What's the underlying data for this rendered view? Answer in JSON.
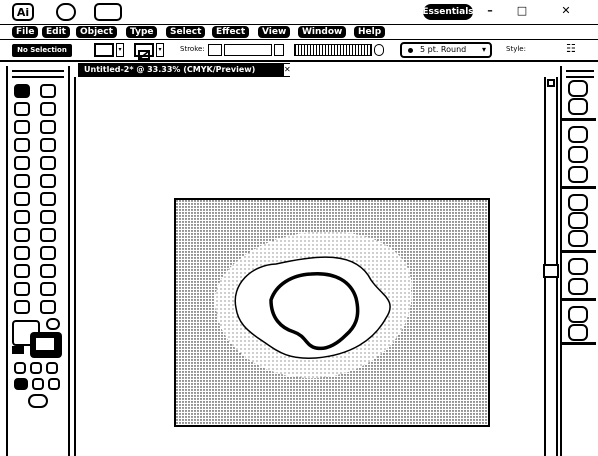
{
  "titlebar": {
    "app_logo": "Ai",
    "workspace_label": "Essentials",
    "minimize_glyph": "–",
    "maximize_glyph": "□",
    "close_glyph": "✕"
  },
  "menu": {
    "items": [
      "File",
      "Edit",
      "Object",
      "Type",
      "Select",
      "Effect",
      "View",
      "Window",
      "Help"
    ]
  },
  "control": {
    "selection_status": "No Selection",
    "stroke_label": "Stroke:",
    "brush_label": "5 pt. Round",
    "opacity_label": "Style:"
  },
  "document": {
    "tab_title": "Untitled-2* @ 33.33% (CMYK/Preview)",
    "close_glyph": "✕"
  },
  "colors": {
    "chrome": "#000000",
    "canvas": "#ffffff",
    "artboard_dots": "#000000"
  },
  "icons": {
    "toolbox": [
      "selection-icon",
      "direct-selection-icon",
      "magic-wand-icon",
      "lasso-icon",
      "pen-icon",
      "type-icon",
      "line-icon",
      "rectangle-icon",
      "paintbrush-icon",
      "pencil-icon",
      "blob-brush-icon",
      "eraser-icon",
      "rotate-icon",
      "scale-icon",
      "warp-icon",
      "free-transform-icon",
      "symbol-sprayer-icon",
      "graph-icon",
      "mesh-icon",
      "gradient-icon",
      "eyedropper-icon",
      "blend-icon",
      "live-paint-icon",
      "slice-icon",
      "hand-icon",
      "zoom-icon"
    ],
    "right_panel": [
      "color-icon",
      "color-guide-icon",
      "swatches-icon",
      "brushes-icon",
      "symbols-icon",
      "stroke-icon",
      "gradient-icon",
      "transparency-icon",
      "appearance-icon",
      "graphic-styles-icon",
      "layers-icon",
      "artboards-icon"
    ]
  }
}
